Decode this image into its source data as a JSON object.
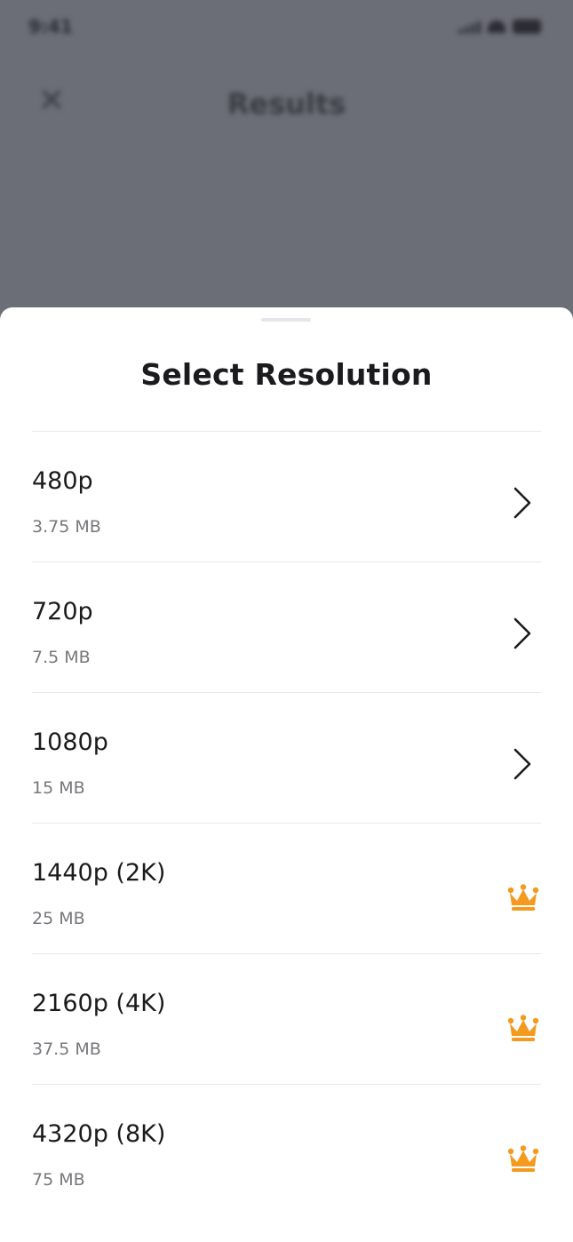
{
  "status_bar": {
    "time": "9:41"
  },
  "background": {
    "close_icon": "close-icon",
    "title": "Results"
  },
  "sheet": {
    "title": "Select Resolution",
    "resolutions": [
      {
        "label": "480p",
        "size": "3.75 MB",
        "icon": "chevron-right-icon",
        "premium": false
      },
      {
        "label": "720p",
        "size": "7.5 MB",
        "icon": "chevron-right-icon",
        "premium": false
      },
      {
        "label": "1080p",
        "size": "15 MB",
        "icon": "chevron-right-icon",
        "premium": false
      },
      {
        "label": "1440p (2K)",
        "size": "25 MB",
        "icon": "crown-icon",
        "premium": true
      },
      {
        "label": "2160p (4K)",
        "size": "37.5 MB",
        "icon": "crown-icon",
        "premium": true
      },
      {
        "label": "4320p (8K)",
        "size": "75 MB",
        "icon": "crown-icon",
        "premium": true
      }
    ]
  },
  "colors": {
    "overlay": "#6b6e76",
    "crown": "#f39a1f",
    "text_primary": "#1b1b1d",
    "text_secondary": "#77787c"
  }
}
